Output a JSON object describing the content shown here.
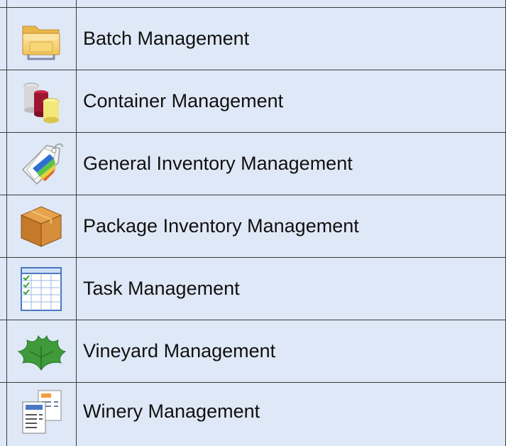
{
  "menu": {
    "items": [
      {
        "label": "Batch Management",
        "icon": "folder-icon"
      },
      {
        "label": "Container Management",
        "icon": "containers-icon"
      },
      {
        "label": "General Inventory Management",
        "icon": "tags-icon"
      },
      {
        "label": "Package Inventory Management",
        "icon": "package-box-icon"
      },
      {
        "label": "Task Management",
        "icon": "task-calendar-icon"
      },
      {
        "label": "Vineyard Management",
        "icon": "vine-leaf-icon"
      },
      {
        "label": "Winery Management",
        "icon": "documents-icon"
      }
    ]
  },
  "colors": {
    "background": "#dfe8f6",
    "border": "#3b3b3b",
    "text": "#111111"
  }
}
